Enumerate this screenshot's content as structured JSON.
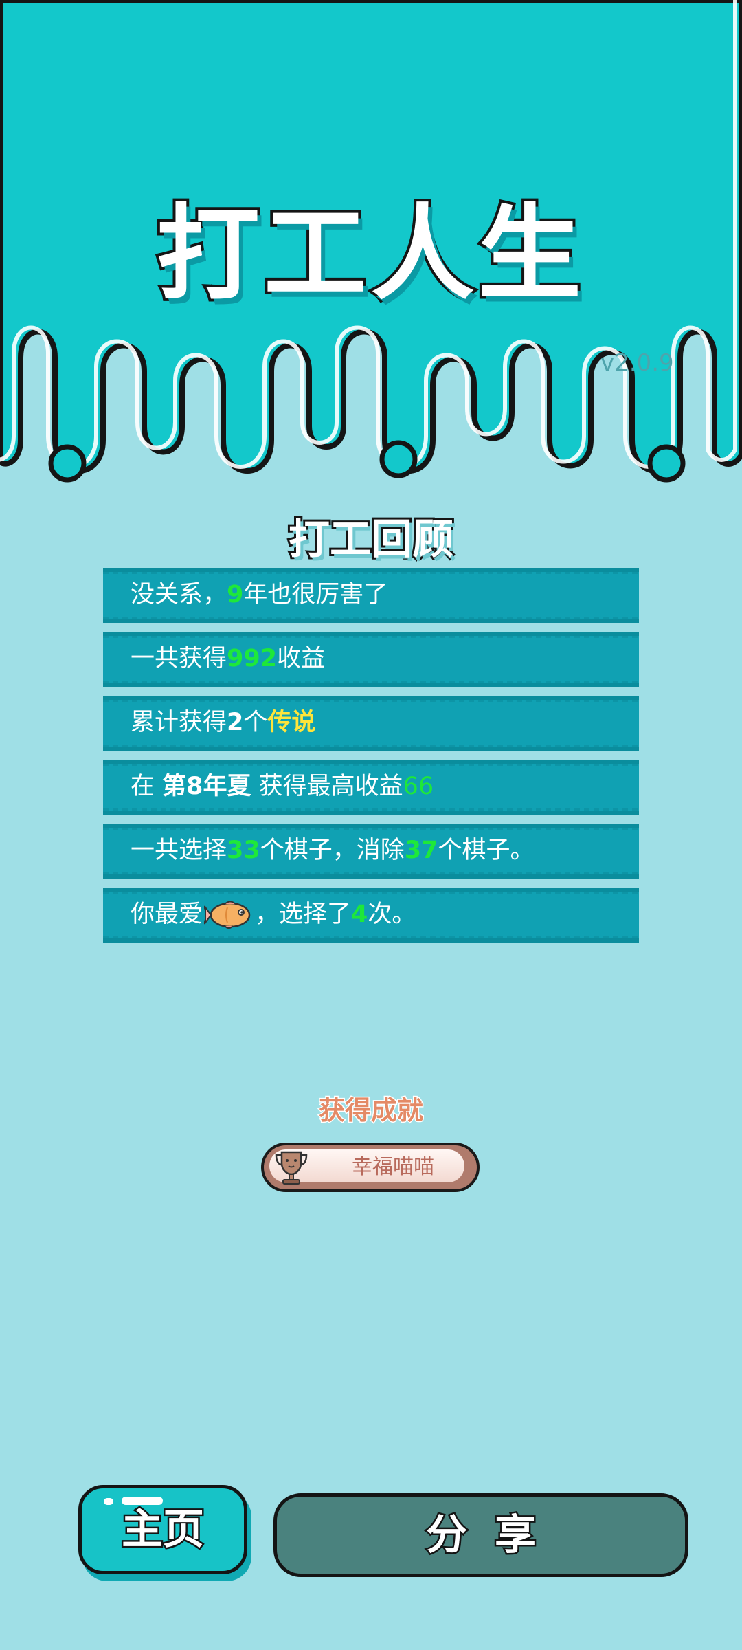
{
  "header": {
    "app_title": "打工人生",
    "version": "v2.0.9",
    "colors": {
      "top": "#13c8cb",
      "body": "#9fdfe6"
    }
  },
  "review": {
    "title": "打工回顾",
    "rows": [
      {
        "pre": "没关系，",
        "num": "9",
        "post": "年也很厉害了"
      },
      {
        "pre": "一共获得",
        "num": "992",
        "post": "收益"
      },
      {
        "pre": "累计获得",
        "num": "2",
        "mid": "个",
        "tag": "传说"
      },
      {
        "pre": "在 ",
        "bold": "第8年夏",
        "mid": " 获得最高收益",
        "num": "66"
      },
      {
        "pre": "一共选择",
        "num": "33",
        "mid": "个棋子，消除",
        "num2": "37",
        "post": "个棋子。"
      },
      {
        "pre": "你最爱",
        "icon": "fish-icon",
        "mid": "，选择了",
        "num": "4",
        "post": "次。"
      }
    ]
  },
  "achievement": {
    "title": "获得成就",
    "badge_label": "幸福喵喵",
    "icon": "trophy-icon"
  },
  "buttons": {
    "home_label": "主页",
    "share_label": "分享"
  }
}
